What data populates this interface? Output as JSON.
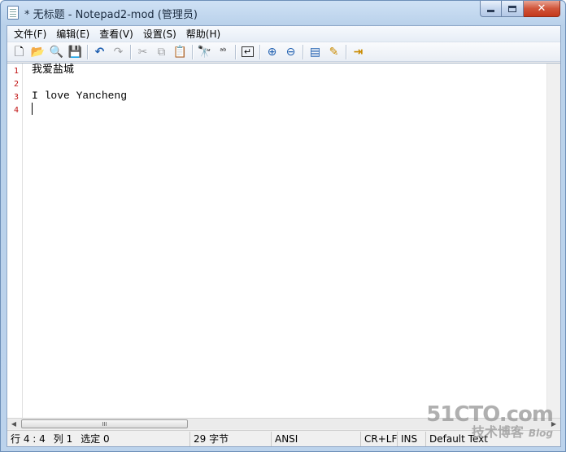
{
  "window": {
    "title": "* 无标题 - Notepad2-mod (管理员)",
    "close_glyph": "✕"
  },
  "menu": {
    "items": [
      "文件(F)",
      "编辑(E)",
      "查看(V)",
      "设置(S)",
      "帮助(H)"
    ]
  },
  "toolbar": {
    "buttons": [
      {
        "icon": "new-file-icon",
        "glyph": "🗋",
        "enabled": true
      },
      {
        "icon": "open-folder-icon",
        "glyph": "📂",
        "enabled": true
      },
      {
        "icon": "browse-icon",
        "glyph": "🔍",
        "enabled": true
      },
      {
        "icon": "save-icon",
        "glyph": "💾",
        "enabled": true
      },
      {
        "icon": "undo-icon",
        "glyph": "↶",
        "enabled": true
      },
      {
        "icon": "redo-icon",
        "glyph": "↷",
        "enabled": false
      },
      {
        "icon": "cut-icon",
        "glyph": "✂",
        "enabled": false
      },
      {
        "icon": "copy-icon",
        "glyph": "⧉",
        "enabled": false
      },
      {
        "icon": "paste-icon",
        "glyph": "📋",
        "enabled": true
      },
      {
        "icon": "find-icon",
        "glyph": "🔭",
        "enabled": true
      },
      {
        "icon": "replace-icon",
        "glyph": "ᵃᵇ",
        "enabled": true
      },
      {
        "icon": "word-wrap-icon",
        "glyph": "↵",
        "enabled": true
      },
      {
        "icon": "zoom-in-icon",
        "glyph": "⊕",
        "enabled": true
      },
      {
        "icon": "zoom-out-icon",
        "glyph": "⊖",
        "enabled": true
      },
      {
        "icon": "scheme-icon",
        "glyph": "▤",
        "enabled": true
      },
      {
        "icon": "customize-scheme-icon",
        "glyph": "✎",
        "enabled": true
      },
      {
        "icon": "exit-icon",
        "glyph": "⇥",
        "enabled": true
      }
    ]
  },
  "editor": {
    "line_numbers": [
      "1",
      "2",
      "3",
      "4"
    ],
    "lines": [
      "我爱盐城",
      "",
      "I love Yancheng",
      ""
    ]
  },
  "scrollbar": {
    "thumb_grip": "III",
    "left_arrow": "◀",
    "right_arrow": "▶"
  },
  "statusbar": {
    "position": "行 4 : 4",
    "column": "列 1",
    "selection": "选定 0",
    "bytes": "29 字节",
    "encoding": "ANSI",
    "line_ending": "CR+LF",
    "mode": "INS",
    "scheme": "Default Text"
  },
  "watermark": {
    "main": "51CTO.com",
    "sub": "技术博客",
    "blog": "Blog"
  }
}
